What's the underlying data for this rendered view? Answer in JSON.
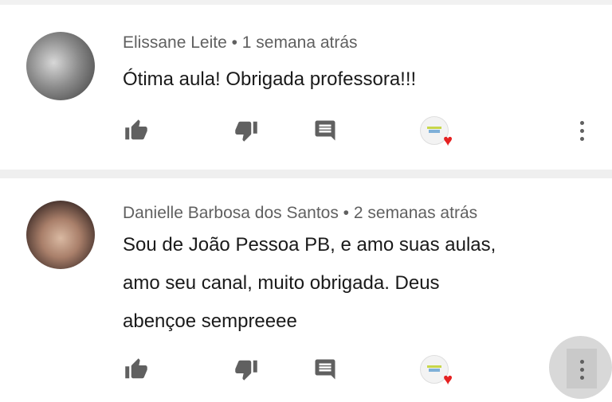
{
  "comments": [
    {
      "author": "Elissane Leite",
      "time": "1 semana atrás",
      "text": "Ótima aula! Obrigada professora!!!",
      "heart_color": "#e52121"
    },
    {
      "author": "Danielle Barbosa dos Santos",
      "time": "2 semanas atrás",
      "text": "Sou de João Pessoa PB,  e amo suas aulas,\namo seu canal, muito obrigada. Deus\nabençoe sempreeee",
      "heart_color": "#e52121"
    }
  ],
  "icons": {
    "like": "thumbs-up-icon",
    "dislike": "thumbs-down-icon",
    "reply": "reply-icon",
    "hearted": "creator-heart-icon",
    "more": "more-vert-icon"
  },
  "meta_separator": " • "
}
